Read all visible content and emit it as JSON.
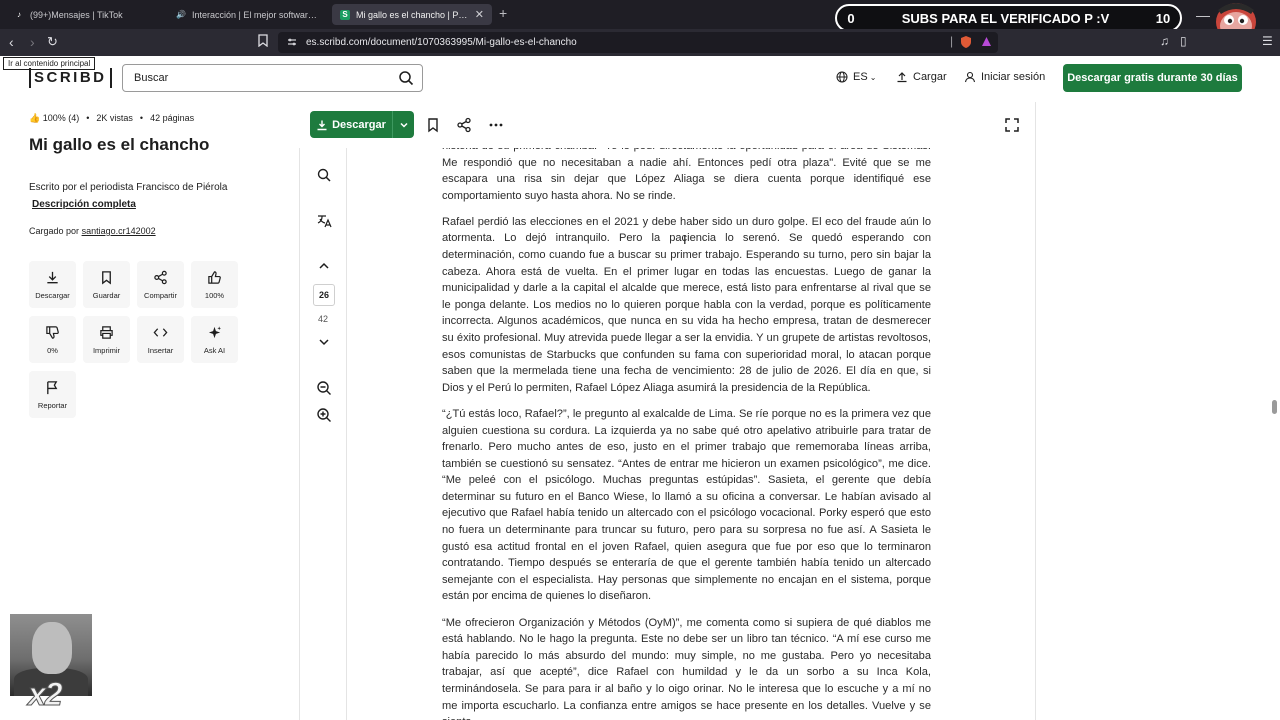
{
  "browser": {
    "tabs": [
      {
        "title": "(99+)Mensajes | TikTok",
        "icon": "tiktok-icon"
      },
      {
        "title": "Interacción | El mejor software pa",
        "icon": "sound-icon"
      },
      {
        "title": "Mi gallo es el chancho | PDF | Al",
        "icon": "scribd-icon"
      }
    ],
    "new_tab": "+",
    "url": "es.scribd.com/document/1070363995/Mi-gallo-es-el-chancho"
  },
  "overlay": {
    "subs_left": "0",
    "subs_text": "SUBS PARA EL VERIFICADO P :V",
    "subs_right": "10",
    "multiplier": "x2"
  },
  "header": {
    "skip_link": "Ir al contenido principal",
    "logo": "SCRIBD",
    "search_placeholder": "Buscar",
    "language": "ES",
    "upload": "Cargar",
    "login": "Iniciar sesión",
    "cta": "Descargar gratis durante 30 días"
  },
  "document": {
    "rating": "100% (4)",
    "views": "2K vistas",
    "pages": "42 páginas",
    "title": "Mi gallo es el chancho",
    "author_line": "Escrito por el periodista Francisco de Piérola",
    "description_link": "Descripción completa",
    "uploaded_label": "Cargado por",
    "uploader": "santiago.cr142002"
  },
  "actions": [
    {
      "label": "Descargar",
      "icon": "download-icon"
    },
    {
      "label": "Guardar",
      "icon": "bookmark-icon"
    },
    {
      "label": "Compartir",
      "icon": "share-icon"
    },
    {
      "label": "100%",
      "icon": "thumbs-up-icon"
    },
    {
      "label": "0%",
      "icon": "thumbs-down-icon"
    },
    {
      "label": "Imprimir",
      "icon": "print-icon"
    },
    {
      "label": "Insertar",
      "icon": "embed-icon"
    },
    {
      "label": "Ask AI",
      "icon": "sparkle-icon"
    },
    {
      "label": "Reportar",
      "icon": "flag-icon"
    }
  ],
  "toolbar": {
    "download": "Descargar"
  },
  "reader": {
    "current_page": "26",
    "total_pages": "42",
    "paragraphs": [
      "historia de su primera chamba: \"Yo le pedí directamente la oportunidad para el área de Sistemas. Me respondió que no necesitaban a nadie ahí. Entonces pedí otra plaza\". Evité que se me escapara una risa sin dejar que López Aliaga se diera cuenta porque identifiqué ese comportamiento suyo hasta ahora. No se rinde.",
      "Rafael perdió las elecciones en el 2021 y debe haber sido un duro golpe. El eco del fraude aún lo atormenta. Lo dejó intranquilo. Pero la paciencia lo serenó. Se quedó esperando con determinación, como cuando fue a buscar su primer trabajo. Esperando su turno, pero sin bajar la cabeza. Ahora está de vuelta. En el primer lugar en todas las encuestas. Luego de ganar la municipalidad y darle a la capital el alcalde que merece, está listo para enfrentarse al rival que se le ponga delante. Los medios no lo quieren porque habla con la verdad, porque es políticamente incorrecta. Algunos académicos, que nunca en su vida ha hecho empresa, tratan de desmerecer su éxito profesional. Muy atrevida puede llegar a ser la envidia. Y un grupete de artistas revoltosos, esos comunistas de Starbucks que confunden su fama con superioridad moral, lo atacan porque saben que la mermelada tiene una fecha de vencimiento: 28 de julio de 2026. El día en que, si Dios y el Perú lo permiten, Rafael López Aliaga asumirá la presidencia de la República.",
      "“¿Tú estás loco, Rafael?”, le pregunto al exalcalde de Lima. Se ríe porque no es la primera vez que alguien cuestiona su cordura. La izquierda ya no sabe qué otro apelativo atribuirle para tratar de frenarlo. Pero mucho antes de eso, justo en el primer trabajo que rememoraba líneas arriba, también se cuestionó su sensatez. “Antes de entrar me hicieron un examen psicológico”, me dice. “Me peleé con el psicólogo. Muchas preguntas estúpidas”. Sasieta, el gerente que debía determinar su futuro en el Banco Wiese, lo llamó a su oficina a conversar. Le habían avisado al ejecutivo que Rafael había tenido un altercado con el psicólogo vocacional. Porky esperó que esto no fuera un determinante para truncar su futuro, pero para su sorpresa no fue así. A Sasieta le gustó esa actitud frontal en el joven Rafael, quien asegura que fue por eso que lo terminaron contratando. Tiempo después se enteraría de que el gerente también había tenido un altercado semejante con el especialista. Hay personas que simplemente no encajan en el sistema, porque están por encima de quienes lo diseñaron.",
      "“Me ofrecieron Organización y Métodos (OyM)”, me comenta como si supiera de qué diablos me está hablando. No le hago la pregunta. Este no debe ser un libro tan técnico. “A mí ese curso me había parecido lo más absurdo del mundo: muy simple, no me gustaba. Pero yo necesitaba trabajar, así que acepté”, dice Rafael con humildad y le da un sorbo a su Inca Kola, terminándosela. Se para para ir al baño y lo oigo orinar. No le interesa que lo escuche y a mí no me importa escucharlo. La confianza entre amigos se hace presente en los detalles. Vuelve y se sienta,"
    ]
  }
}
